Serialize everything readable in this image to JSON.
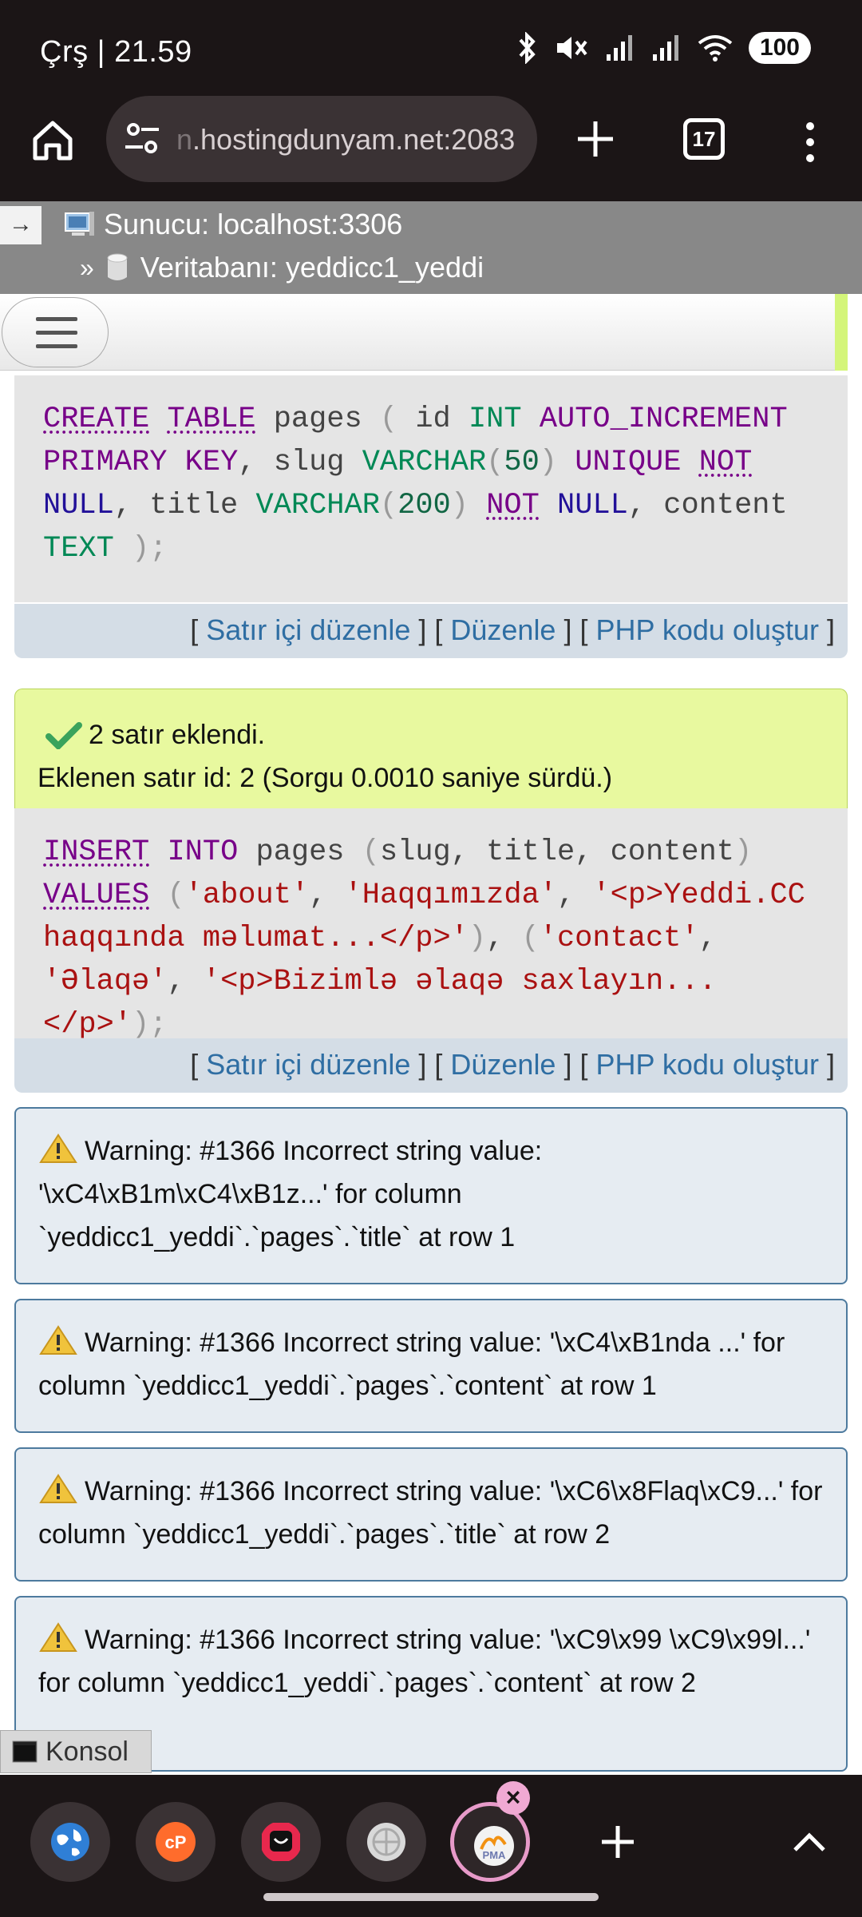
{
  "status": {
    "time": "Çrş | 21.59",
    "battery": "100"
  },
  "browser": {
    "url_prefix": "n",
    "url": ".hostingdunyam.net:2083",
    "tab_count": "17"
  },
  "pma": {
    "server_label": "Sunucu: localhost:3306",
    "db_label": "Veritabanı: yeddicc1_yeddi",
    "arrow": "→",
    "chevron": "»"
  },
  "query1": {
    "links": {
      "inline_edit": "Satır içi düzenle",
      "edit": "Düzenle",
      "php": "PHP kodu oluştur"
    }
  },
  "result2": {
    "message": "2 satır eklendi.",
    "detail": "Eklenen satır id: 2 (Sorgu 0.0010 saniye sürdü.)"
  },
  "query2": {
    "links": {
      "inline_edit": "Satır içi düzenle",
      "edit": "Düzenle",
      "php": "PHP kodu oluştur"
    }
  },
  "warnings": [
    "Warning: #1366 Incorrect string value: '\\xC4\\xB1m\\xC4\\xB1z...' for column `yeddicc1_yeddi`.`pages`.`title` at row 1",
    "Warning: #1366 Incorrect string value: '\\xC4\\xB1nda ...' for column `yeddicc1_yeddi`.`pages`.`content` at row 1",
    "Warning: #1366 Incorrect string value: '\\xC6\\x8Flaq\\xC9...' for column `yeddicc1_yeddi`.`pages`.`title` at row 2",
    "Warning: #1366 Incorrect string value: '\\xC9\\x99 \\xC9\\x99l...' for column `yeddicc1_yeddi`.`pages`.`content` at row 2"
  ],
  "konsol": "Konsol",
  "colors": {
    "accent_link": "#2f6ea3",
    "success_bg": "#e8f99f",
    "warning_border": "#4d7a9e"
  },
  "bottom_tabs": [
    "globe-icon",
    "cpanel-icon",
    "app-icon",
    "globe-gray-icon",
    "phpmyadmin-icon"
  ]
}
